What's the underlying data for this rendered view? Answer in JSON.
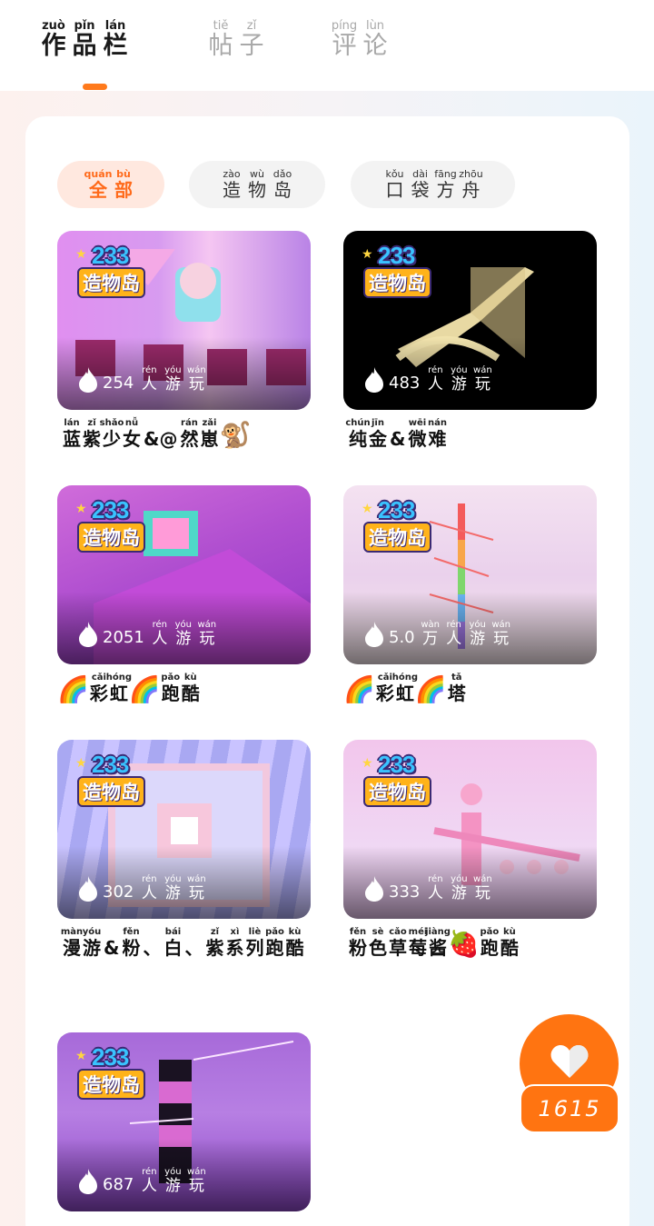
{
  "tabs": [
    {
      "chars": [
        {
          "py": "zuò",
          "hz": "作"
        },
        {
          "py": "pǐn",
          "hz": "品"
        },
        {
          "py": "lán",
          "hz": "栏"
        }
      ],
      "active": true
    },
    {
      "chars": [
        {
          "py": "tiě",
          "hz": "帖"
        },
        {
          "py": "zǐ",
          "hz": "子"
        }
      ],
      "active": false
    },
    {
      "chars": [
        {
          "py": "píng",
          "hz": "评"
        },
        {
          "py": "lùn",
          "hz": "论"
        }
      ],
      "active": false
    }
  ],
  "filters": [
    {
      "chars": [
        {
          "py": "quán",
          "hz": "全"
        },
        {
          "py": "bù",
          "hz": "部"
        }
      ],
      "selected": true
    },
    {
      "chars": [
        {
          "py": "zào",
          "hz": "造"
        },
        {
          "py": "wù",
          "hz": "物"
        },
        {
          "py": "dǎo",
          "hz": "岛"
        }
      ],
      "selected": false
    },
    {
      "chars": [
        {
          "py": "kǒu",
          "hz": "口"
        },
        {
          "py": "dài",
          "hz": "袋"
        },
        {
          "py": "fāng",
          "hz": "方"
        },
        {
          "py": "zhōu",
          "hz": "舟"
        }
      ],
      "selected": false
    }
  ],
  "logo": {
    "number": "233",
    "name": "造物岛"
  },
  "play_suffix": [
    {
      "py": "rén",
      "hz": "人"
    },
    {
      "py": "yóu",
      "hz": "游"
    },
    {
      "py": "wán",
      "hz": "玩"
    }
  ],
  "play_suffix_wan": [
    {
      "py": "wàn",
      "hz": "万"
    },
    {
      "py": "rén",
      "hz": "人"
    },
    {
      "py": "yóu",
      "hz": "游"
    },
    {
      "py": "wán",
      "hz": "玩"
    }
  ],
  "games": [
    {
      "count": "254",
      "wan": false,
      "title": [
        {
          "py": "lán",
          "hz": "蓝"
        },
        {
          "py": "zǐ",
          "hz": "紫"
        },
        {
          "py": "shǎo",
          "hz": "少"
        },
        {
          "py": "nǚ",
          "hz": "女"
        },
        {
          "plain": "&@"
        },
        {
          "py": "rán",
          "hz": "然"
        },
        {
          "py": "zǎi",
          "hz": "崽"
        },
        {
          "emoji": "🐒"
        }
      ]
    },
    {
      "count": "483",
      "wan": false,
      "title": [
        {
          "py": "chún",
          "hz": "纯"
        },
        {
          "py": "jīn",
          "hz": "金"
        },
        {
          "plain": "&"
        },
        {
          "py": "wēi",
          "hz": "微"
        },
        {
          "py": "nán",
          "hz": "难"
        }
      ]
    },
    {
      "count": "2051",
      "wan": false,
      "title": [
        {
          "emoji": "🌈"
        },
        {
          "py": "cǎi",
          "hz": "彩"
        },
        {
          "py": "hóng",
          "hz": "虹"
        },
        {
          "emoji": "🌈"
        },
        {
          "py": "pǎo",
          "hz": "跑"
        },
        {
          "py": "kù",
          "hz": "酷"
        }
      ]
    },
    {
      "count": "5.0",
      "wan": true,
      "title": [
        {
          "emoji": "🌈"
        },
        {
          "py": "cǎi",
          "hz": "彩"
        },
        {
          "py": "hóng",
          "hz": "虹"
        },
        {
          "emoji": "🌈"
        },
        {
          "py": "tǎ",
          "hz": "塔"
        }
      ]
    },
    {
      "count": "302",
      "wan": false,
      "title": [
        {
          "py": "màn",
          "hz": "漫"
        },
        {
          "py": "yóu",
          "hz": "游"
        },
        {
          "plain": "&"
        },
        {
          "py": "fěn",
          "hz": "粉"
        },
        {
          "plain": "、"
        },
        {
          "py": "bái",
          "hz": "白"
        },
        {
          "plain": "、"
        },
        {
          "py": "zǐ",
          "hz": "紫"
        },
        {
          "py": "xì",
          "hz": "系"
        },
        {
          "py": "liè",
          "hz": "列"
        },
        {
          "py": "pǎo",
          "hz": "跑"
        },
        {
          "py": "kù",
          "hz": "酷"
        }
      ]
    },
    {
      "count": "333",
      "wan": false,
      "title": [
        {
          "py": "fěn",
          "hz": "粉"
        },
        {
          "py": "sè",
          "hz": "色"
        },
        {
          "py": "cǎo",
          "hz": "草"
        },
        {
          "py": "méi",
          "hz": "莓"
        },
        {
          "py": "jiàng",
          "hz": "酱"
        },
        {
          "emoji": "🍓"
        },
        {
          "py": "pǎo",
          "hz": "跑"
        },
        {
          "py": "kù",
          "hz": "酷"
        }
      ]
    },
    {
      "count": "687",
      "wan": false,
      "title": []
    }
  ],
  "like": {
    "count": "1615",
    "icon": "heart-icon"
  }
}
